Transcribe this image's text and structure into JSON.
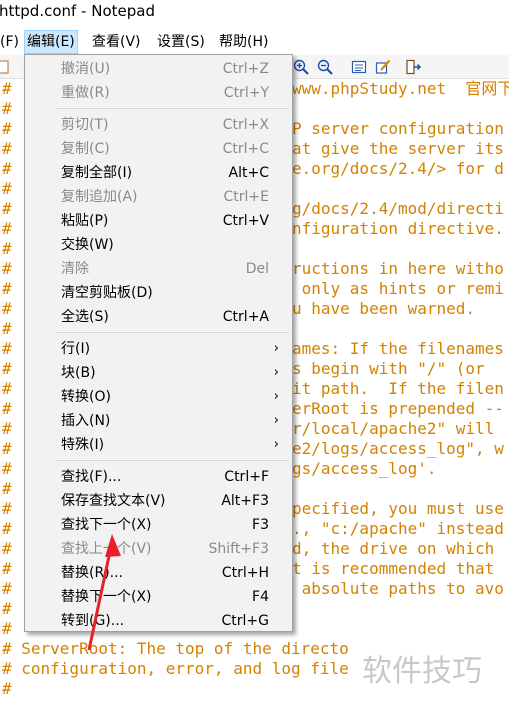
{
  "window": {
    "title": "httpd.conf - Notepad"
  },
  "menubar": {
    "items": [
      {
        "label": "(F)"
      },
      {
        "label": "编辑(E)"
      },
      {
        "label": "查看(V)"
      },
      {
        "label": "设置(S)"
      },
      {
        "label": "帮助(H)"
      }
    ],
    "active_index": 1
  },
  "toolbar": {
    "icons": [
      "new-file-icon",
      "zoom-in-icon",
      "zoom-out-icon",
      "view-icon",
      "edit-icon",
      "exit-icon"
    ]
  },
  "editor": {
    "lines": [
      {
        "gutter": "#",
        "text": "www.phpStudy.net  官网下"
      },
      {
        "gutter": "#",
        "text": ""
      },
      {
        "gutter": "#",
        "text": "P server configuration"
      },
      {
        "gutter": "#",
        "text": "at give the server its"
      },
      {
        "gutter": "#",
        "text": "e.org/docs/2.4/> for d"
      },
      {
        "gutter": "#",
        "text": ""
      },
      {
        "gutter": "#",
        "text": "g/docs/2.4/mod/directi"
      },
      {
        "gutter": "#",
        "text": "nfiguration directive."
      },
      {
        "gutter": "#",
        "text": ""
      },
      {
        "gutter": "#",
        "text": "ructions in here witho"
      },
      {
        "gutter": "#",
        "text": " only as hints or remi"
      },
      {
        "gutter": "#",
        "text": "u have been warned."
      },
      {
        "gutter": "#",
        "text": ""
      },
      {
        "gutter": "#",
        "text": "ames: If the filenames"
      },
      {
        "gutter": "#",
        "text": "s begin with \"/\" (or"
      },
      {
        "gutter": "#",
        "text": "it path.  If the filen"
      },
      {
        "gutter": "#",
        "text": "erRoot is prepended --"
      },
      {
        "gutter": "#",
        "text": "r/local/apache2\" will"
      },
      {
        "gutter": "#",
        "text": "e2/logs/access_log\", w"
      },
      {
        "gutter": "#",
        "text": "gs/access_log'."
      },
      {
        "gutter": "#",
        "text": ""
      },
      {
        "gutter": "#",
        "text": "pecified, you must use"
      },
      {
        "gutter": "#",
        "text": "., \"c:/apache\" instead"
      },
      {
        "gutter": "#",
        "text": "d, the drive on which"
      },
      {
        "gutter": "#",
        "text": "t is recommended that"
      },
      {
        "gutter": "#",
        "text": " absolute paths to avo"
      },
      {
        "gutter": "#",
        "text": ""
      },
      {
        "gutter": "#",
        "text": ""
      },
      {
        "gutter": "#",
        "text": "# ServerRoot: The top of the directo"
      },
      {
        "gutter": "#",
        "text": "# configuration, error, and log file"
      },
      {
        "gutter": "#",
        "text": "#"
      }
    ]
  },
  "edit_menu": {
    "items": [
      {
        "label": "撤消(U)",
        "shortcut": "Ctrl+Z",
        "enabled": false,
        "submenu": false
      },
      {
        "label": "重做(R)",
        "shortcut": "Ctrl+Y",
        "enabled": false,
        "submenu": false
      },
      {
        "sep": true
      },
      {
        "label": "剪切(T)",
        "shortcut": "Ctrl+X",
        "enabled": false,
        "submenu": false
      },
      {
        "label": "复制(C)",
        "shortcut": "Ctrl+C",
        "enabled": false,
        "submenu": false
      },
      {
        "label": "复制全部(I)",
        "shortcut": "Alt+C",
        "enabled": true,
        "submenu": false
      },
      {
        "label": "复制追加(A)",
        "shortcut": "Ctrl+E",
        "enabled": false,
        "submenu": false
      },
      {
        "label": "粘贴(P)",
        "shortcut": "Ctrl+V",
        "enabled": true,
        "submenu": false
      },
      {
        "label": "交换(W)",
        "shortcut": "",
        "enabled": true,
        "submenu": false
      },
      {
        "label": "清除",
        "shortcut": "Del",
        "enabled": false,
        "submenu": false
      },
      {
        "label": "清空剪贴板(D)",
        "shortcut": "",
        "enabled": true,
        "submenu": false
      },
      {
        "label": "全选(S)",
        "shortcut": "Ctrl+A",
        "enabled": true,
        "submenu": false
      },
      {
        "sep": true
      },
      {
        "label": "行(I)",
        "shortcut": "",
        "enabled": true,
        "submenu": true
      },
      {
        "label": "块(B)",
        "shortcut": "",
        "enabled": true,
        "submenu": true
      },
      {
        "label": "转换(O)",
        "shortcut": "",
        "enabled": true,
        "submenu": true
      },
      {
        "label": "插入(N)",
        "shortcut": "",
        "enabled": true,
        "submenu": true
      },
      {
        "label": "特殊(I)",
        "shortcut": "",
        "enabled": true,
        "submenu": true
      },
      {
        "sep": true
      },
      {
        "label": "查找(F)...",
        "shortcut": "Ctrl+F",
        "enabled": true,
        "submenu": false
      },
      {
        "label": "保存查找文本(V)",
        "shortcut": "Alt+F3",
        "enabled": true,
        "submenu": false
      },
      {
        "label": "查找下一个(X)",
        "shortcut": "F3",
        "enabled": true,
        "submenu": false
      },
      {
        "label": "查找上一个(V)",
        "shortcut": "Shift+F3",
        "enabled": false,
        "submenu": false
      },
      {
        "label": "替换(R)...",
        "shortcut": "Ctrl+H",
        "enabled": true,
        "submenu": false
      },
      {
        "label": "替换下一个(X)",
        "shortcut": "F4",
        "enabled": true,
        "submenu": false
      },
      {
        "label": "转到(G)...",
        "shortcut": "Ctrl+G",
        "enabled": true,
        "submenu": false
      }
    ]
  },
  "watermark": {
    "text": "软件技巧"
  },
  "colors": {
    "comment_text": "#d48200",
    "arrow": "#e8202a",
    "menu_active_bg": "#cce8ff",
    "popup_bg": "#f2f2f2",
    "disabled_text": "#8a8a8a"
  }
}
